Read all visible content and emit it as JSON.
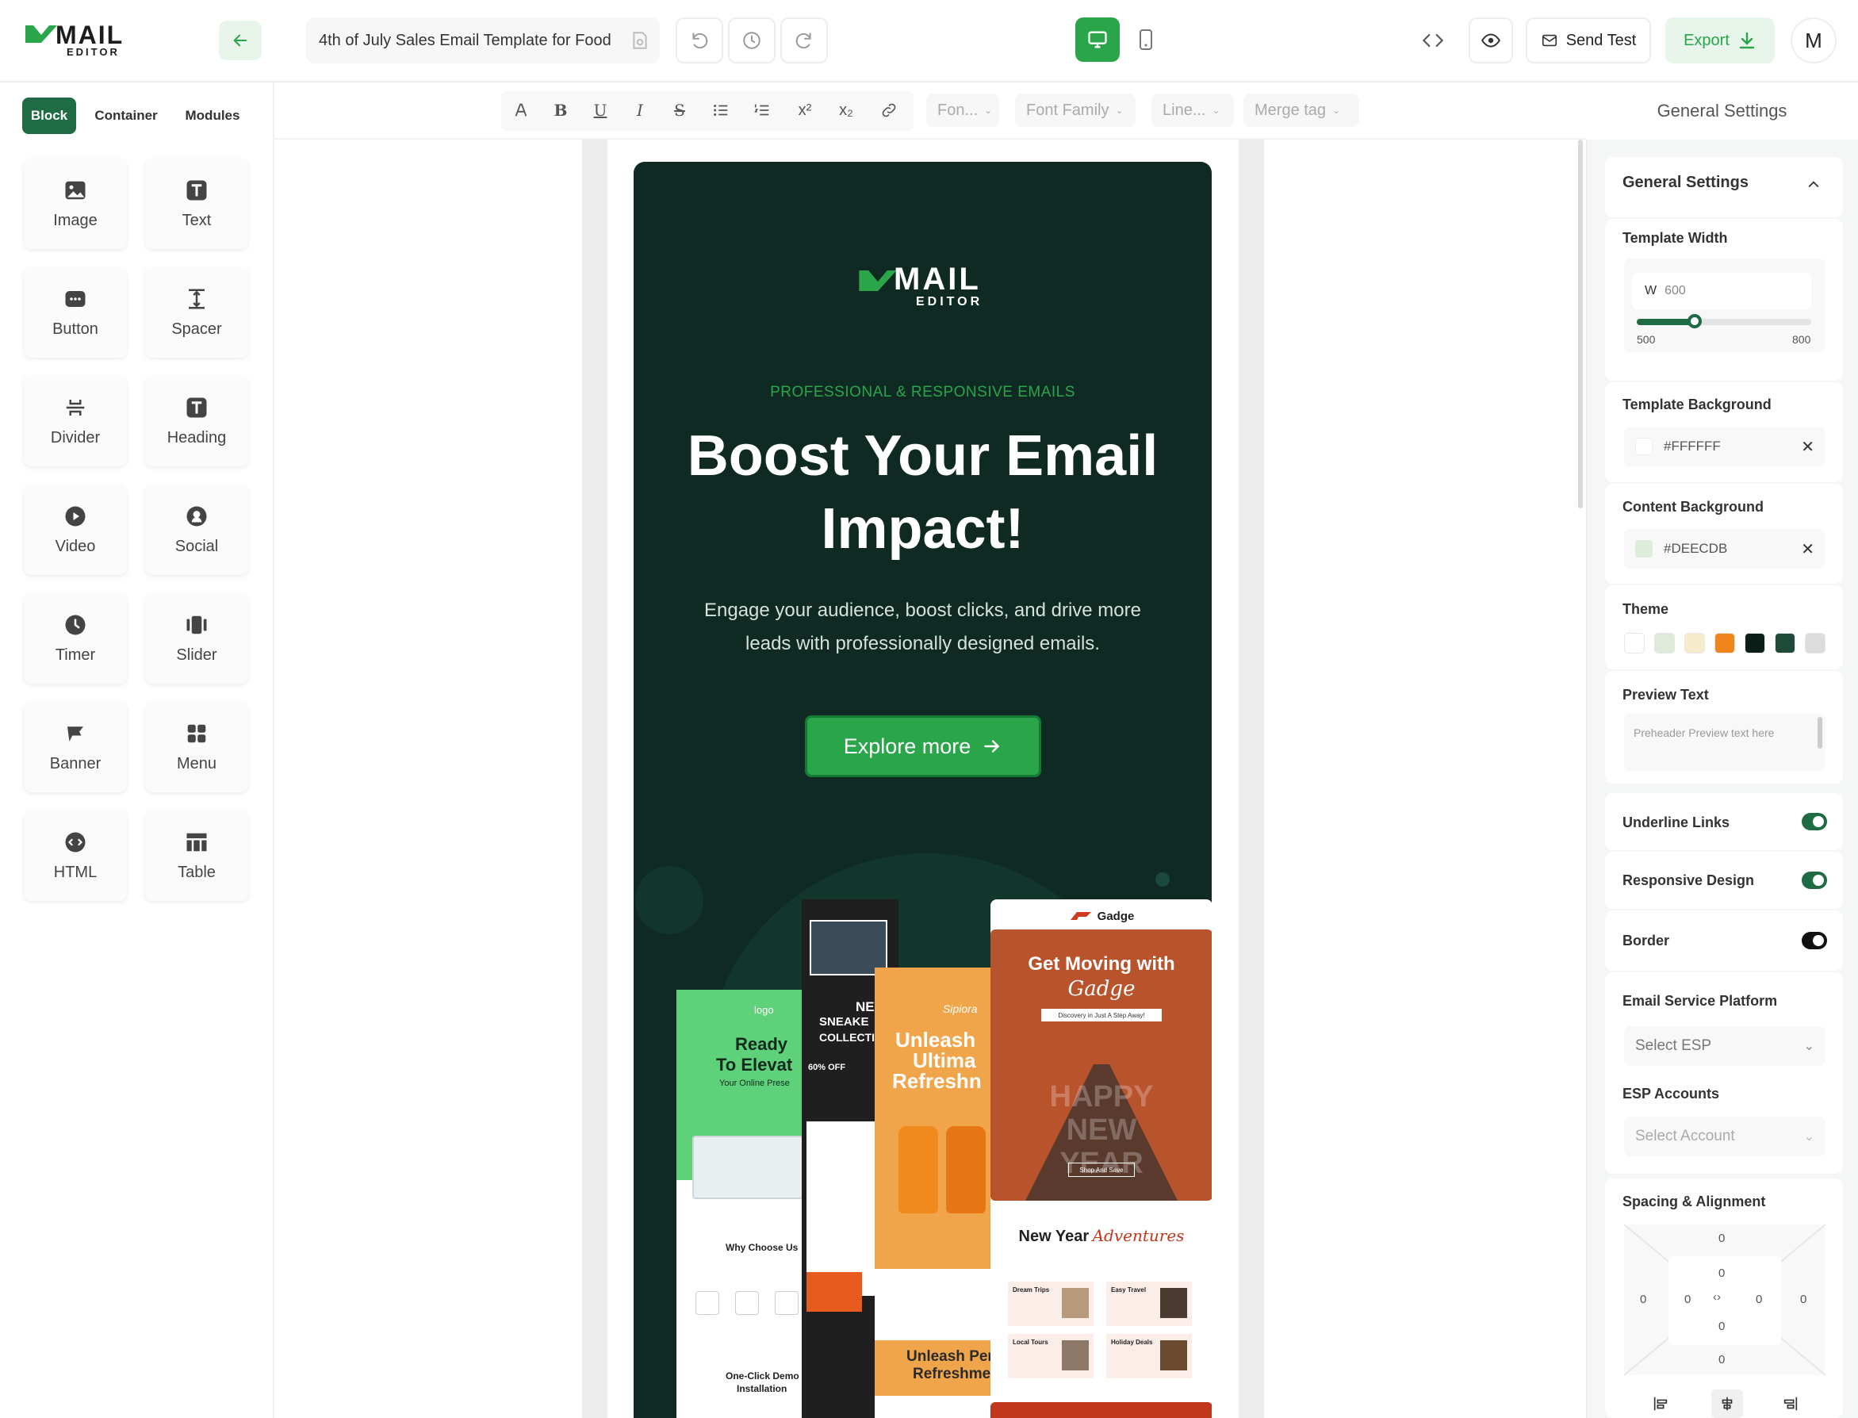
{
  "app": {
    "logo_top": "MAIL",
    "logo_bottom": "EDITOR",
    "template_name": "4th of July Sales Email Template for Food",
    "send_test_label": "Send Test",
    "export_label": "Export",
    "avatar_initial": "M",
    "accent": "#2aa54a",
    "dark_green": "#1f6b43"
  },
  "format_bar": {
    "font_size_placeholder": "Fon...",
    "font_family_placeholder": "Font Family",
    "line_height_placeholder": "Line...",
    "merge_tag_placeholder": "Merge tag"
  },
  "left_panel": {
    "tabs": [
      {
        "label": "Block",
        "active": true
      },
      {
        "label": "Container",
        "active": false
      },
      {
        "label": "Modules",
        "active": false
      }
    ],
    "blocks": [
      {
        "label": "Image",
        "icon": "image-icon"
      },
      {
        "label": "Text",
        "icon": "text-icon"
      },
      {
        "label": "Button",
        "icon": "button-icon"
      },
      {
        "label": "Spacer",
        "icon": "spacer-icon"
      },
      {
        "label": "Divider",
        "icon": "divider-icon"
      },
      {
        "label": "Heading",
        "icon": "heading-icon"
      },
      {
        "label": "Video",
        "icon": "video-icon"
      },
      {
        "label": "Social",
        "icon": "social-icon"
      },
      {
        "label": "Timer",
        "icon": "timer-icon"
      },
      {
        "label": "Slider",
        "icon": "slider-icon"
      },
      {
        "label": "Banner",
        "icon": "banner-icon"
      },
      {
        "label": "Menu",
        "icon": "menu-icon"
      },
      {
        "label": "HTML",
        "icon": "html-icon"
      },
      {
        "label": "Table",
        "icon": "table-icon"
      }
    ]
  },
  "email": {
    "logo_top": "MAIL",
    "logo_bottom": "EDITOR",
    "eyebrow": "PROFESSIONAL & RESPONSIVE EMAILS",
    "headline_line1": "Boost Your Email",
    "headline_line2": "Impact!",
    "body_line1": "Engage your audience, boost clicks, and drive more",
    "body_line2": "leads with professionally designed emails.",
    "cta_label": "Explore more",
    "background": "#0e2a23",
    "previews": {
      "green_logo": "logo",
      "green_title1": "Ready",
      "green_title2": "To Elevat",
      "green_sub": "Your Online Prese",
      "green_why": "Why Choose Us",
      "green_oneclick1": "One-Click Demo",
      "green_oneclick2": "Installation",
      "dark_title1": "NE",
      "dark_title2": "SNEAKE",
      "dark_title3": "COLLECTI",
      "dark_off": "60% OFF",
      "orange_brand": "Sipiora",
      "orange_title1": "Unleash",
      "orange_title2": "Ultima",
      "orange_title3": "Refreshn",
      "orange_bottom1": "Unleash Per",
      "orange_bottom2": "Refreshme",
      "gadge_brand": "Gadge",
      "gadge_title1": "Get Moving with",
      "gadge_title2": "Gadge",
      "gadge_banner": "Discovery in Just A Step Away!",
      "gadge_overlay": "HAPPY NEW YEAR",
      "gadge_shop": "Shop And Save",
      "gadge_new_year": "New Year",
      "gadge_adventures": "Adventures",
      "gadge_items": [
        "Dream Trips",
        "Easy Travel",
        "Local Tours",
        "Holiday Deals"
      ]
    }
  },
  "right_panel": {
    "header": "General Settings",
    "section_title": "General Settings",
    "template_width_label": "Template Width",
    "width_prefix": "W",
    "width_value": "600",
    "width_min": "500",
    "width_max": "800",
    "width_fraction": 0.333,
    "template_bg_label": "Template Background",
    "template_bg_value": "#FFFFFF",
    "content_bg_label": "Content Background",
    "content_bg_value": "#DEECDB",
    "theme_label": "Theme",
    "theme_colors": [
      "#ffffff",
      "#dfeadb",
      "#f6ebcb",
      "#f0851c",
      "#0b1f18",
      "#1f4a37",
      "#dcdcdc"
    ],
    "preview_text_label": "Preview Text",
    "preview_text_placeholder": "Preheader Preview text here",
    "underline_links_label": "Underline Links",
    "underline_links_on": true,
    "responsive_label": "Responsive Design",
    "responsive_on": true,
    "border_label": "Border",
    "border_on": false,
    "esp_label": "Email Service Platform",
    "esp_placeholder": "Select ESP",
    "esp_accounts_label": "ESP Accounts",
    "esp_accounts_placeholder": "Select Account",
    "spacing_label": "Spacing & Alignment",
    "spacing_values": [
      "0",
      "0",
      "0",
      "0",
      "0",
      "0",
      "0",
      "0",
      "0"
    ]
  }
}
